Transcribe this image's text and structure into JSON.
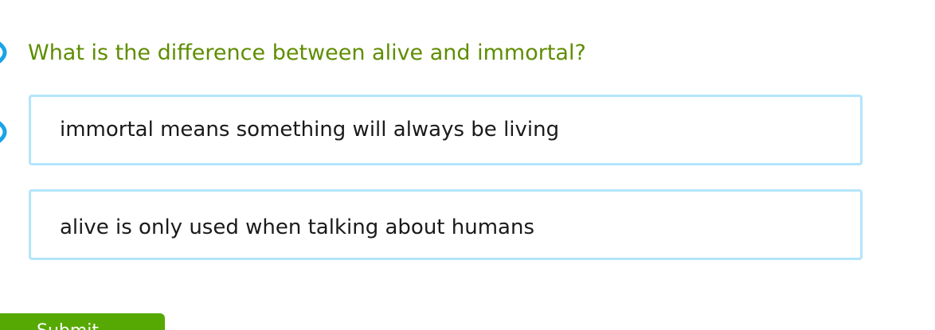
{
  "question": {
    "text": "What is the difference between alive and immortal?",
    "color": "#5e8d00",
    "speaker_icon": "speaker-icon"
  },
  "choices": [
    {
      "label": "immortal means something will always be living",
      "speaker_icon": "speaker-icon"
    },
    {
      "label": "alive is only used when talking about humans"
    }
  ],
  "submit": {
    "label": "Submit",
    "color": "#56a902"
  },
  "colors": {
    "choice_border": "#b3e5fc",
    "speaker": "#1aa3e8"
  }
}
